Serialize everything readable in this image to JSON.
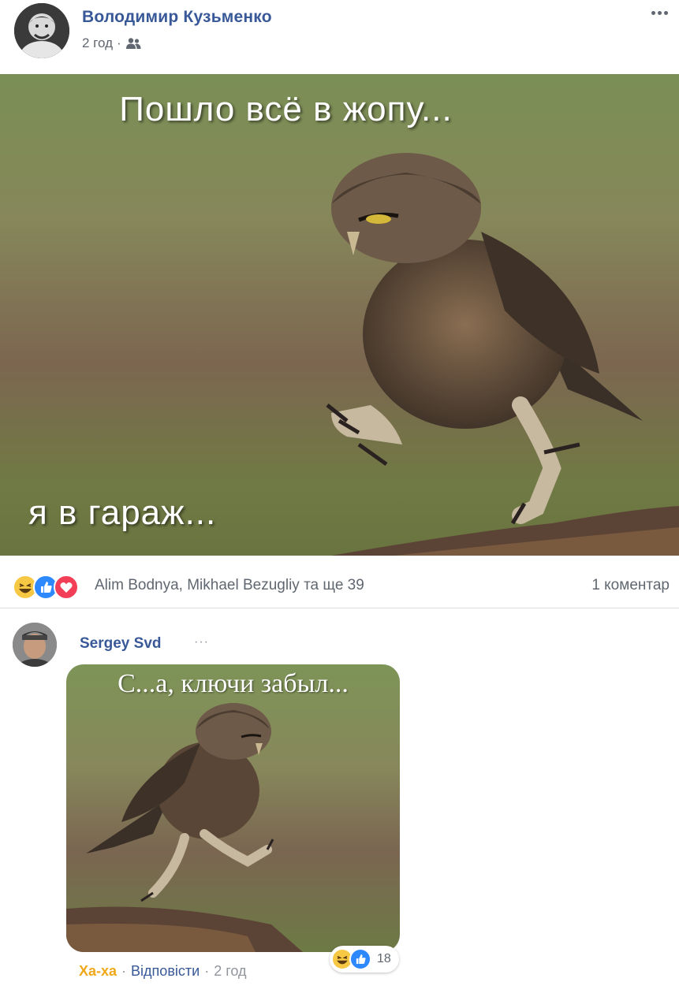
{
  "post": {
    "author": "Володимир Кузьменко",
    "time": "2 год",
    "meta_separator": "·",
    "meme_top_text": "Пошло всё в жопу...",
    "meme_bottom_text": "я в гараж..."
  },
  "reactions": {
    "icons": [
      "haha-icon",
      "like-icon",
      "love-icon"
    ],
    "reactors_text": "Alim Bodnya, Mikhael Bezugliy та ще 39",
    "comment_count": "1 коментар"
  },
  "comment": {
    "author": "Sergey Svd",
    "more": "···",
    "image_text": "С...а, ключи забыл...",
    "actions": {
      "haha": "Ха-ха",
      "separator": "·",
      "reply": "Відповісти",
      "time": "2 год"
    },
    "reaction_icons": [
      "haha-icon",
      "like-icon"
    ],
    "reaction_count": "18"
  },
  "colors": {
    "link_blue": "#385898",
    "meta_gray": "#616770",
    "haha_yellow": "#f0a818",
    "like_blue": "#2e89ff",
    "love_red": "#f33e58"
  }
}
